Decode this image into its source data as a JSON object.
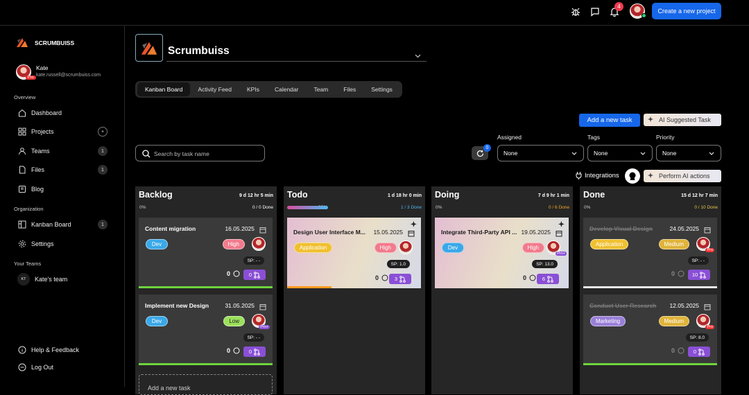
{
  "topbar": {
    "notification_count": "4",
    "create_label": "Create a new project"
  },
  "brand": {
    "name": "SCRUMBUISS"
  },
  "user": {
    "name": "Kate",
    "email": "kate.russell@scrumbuiss.com",
    "badge": "Pro"
  },
  "sidebar": {
    "overview_label": "Overview",
    "items": [
      {
        "label": "Dashboard",
        "icon": "home-icon"
      },
      {
        "label": "Projects",
        "icon": "grid-icon",
        "action": "+"
      },
      {
        "label": "Teams",
        "icon": "teams-icon",
        "count": "1"
      },
      {
        "label": "Files",
        "icon": "file-icon",
        "count": "1"
      },
      {
        "label": "Blog",
        "icon": "book-icon"
      }
    ],
    "organization_label": "Organization",
    "org_items": [
      {
        "label": "Kanban Board",
        "icon": "kanban-icon",
        "count": "1"
      },
      {
        "label": "Settings",
        "icon": "gear-icon"
      }
    ],
    "teams_label": "Your Teams",
    "team": {
      "initials": "KT",
      "name": "Kate's team"
    },
    "help_label": "Help & Feedback",
    "logout_label": "Log Out"
  },
  "project": {
    "name": "Scrumbuiss"
  },
  "tabs": [
    "Kanban Board",
    "Activity Feed",
    "KPIs",
    "Calendar",
    "Team",
    "Files",
    "Settings"
  ],
  "actions": {
    "add_task": "Add a new task",
    "ai_suggested": "AI Suggested Task",
    "integrations": "Integrations",
    "perform_ai": "Perform AI actions",
    "refresh_count": "0"
  },
  "search": {
    "placeholder": "Search by task name"
  },
  "filters": {
    "assigned_label": "Assigned",
    "assigned_value": "None",
    "tags_label": "Tags",
    "tags_value": "None",
    "priority_label": "Priority",
    "priority_value": "None"
  },
  "columns": [
    {
      "title": "Backlog",
      "time": "9 d 12 hr 5 min",
      "percent": "0%",
      "done": "0 / 0 Done",
      "done_color": "#ffffff",
      "progress": 0,
      "cards": [
        {
          "title": "Content migration",
          "date": "16.05.2025",
          "tag": "Dev",
          "priority": "High",
          "sp": "SP: - -",
          "count": "0",
          "prs": "0",
          "av_badge": ""
        },
        {
          "title": "Implement new Design",
          "date": "31.05.2025",
          "tag": "Dev",
          "priority": "Low",
          "sp": "SP: - -",
          "count": "0",
          "prs": "0",
          "av_badge": "Pro+"
        }
      ],
      "add_label": "Add a new task"
    },
    {
      "title": "Todo",
      "time": "1 d 18 hr 0 min",
      "percent": "33%",
      "done": "1 / 3 Done",
      "done_color": "#4fb8f0",
      "progress": 0.33,
      "cards": [
        {
          "title": "Design User Interface M...",
          "date": "15.05.2025",
          "tag": "Application",
          "priority": "High",
          "sp": "SP: 1.0",
          "count": "0",
          "prs": "3",
          "av_badge": ""
        }
      ]
    },
    {
      "title": "Doing",
      "time": "7 d 9 hr 1 min",
      "percent": "0%",
      "done": "0 / 6 Done",
      "done_color": "#f5a623",
      "progress": 0,
      "cards": [
        {
          "title": "Integrate Third-Party API ...",
          "date": "19.05.2025",
          "tag": "Dev",
          "priority": "High",
          "sp": "SP: 13.0",
          "count": "0",
          "prs": "6",
          "av_badge": "Pro+"
        }
      ]
    },
    {
      "title": "Done",
      "time": "15 d 12 hr 7 min",
      "percent": "0%",
      "done": "0 / 10 Done",
      "done_color": "#e8c84a",
      "progress": 0,
      "cards": [
        {
          "title": "Develop Visual Design",
          "date": "24.05.2025",
          "tag": "Application",
          "priority": "Medium",
          "sp": "SP: - -",
          "count": "0",
          "prs": "10",
          "av_badge": "Pro"
        },
        {
          "title": "Conduct User Research",
          "date": "12.05.2025",
          "tag": "Marketing",
          "priority": "Medium",
          "sp": "SP: 8.0",
          "count": "0",
          "prs": "0",
          "av_badge": "Pro"
        }
      ]
    }
  ],
  "colors": {
    "accent": "#1667ea",
    "dev": "#3aa8e8",
    "high": "#f27a8c",
    "low": "#9be05a",
    "application": "#f0c030",
    "medium": "#e0b43a",
    "marketing": "#9a7fd8",
    "bar_green": "#6dd43e",
    "pr": "#8a4fd6"
  }
}
